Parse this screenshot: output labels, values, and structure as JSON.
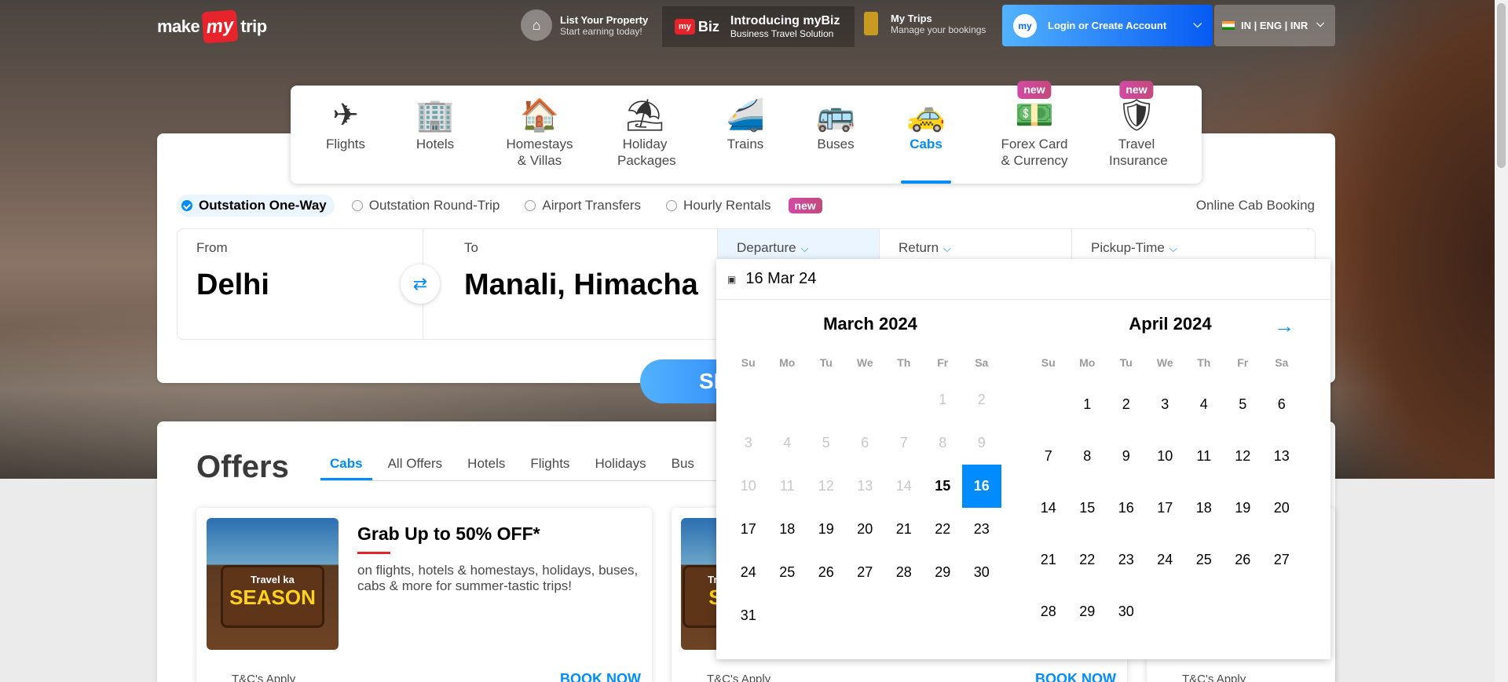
{
  "header": {
    "logo": {
      "part1": "make",
      "part2": "my",
      "part3": "trip"
    },
    "list_property": {
      "title": "List Your Property",
      "subtitle": "Start earning today!"
    },
    "mybiz": {
      "logo": "my",
      "word": "Biz",
      "title": "Introducing myBiz",
      "subtitle": "Business Travel Solution"
    },
    "my_trips": {
      "title": "My Trips",
      "subtitle": "Manage your bookings"
    },
    "login": {
      "label": "Login or Create Account",
      "avatar": "my"
    },
    "locale": {
      "label": "IN | ENG | INR"
    }
  },
  "nav": [
    {
      "label": "Flights",
      "icon": "plane-icon",
      "glyph": "✈"
    },
    {
      "label": "Hotels",
      "icon": "hotel-icon",
      "glyph": "🏢"
    },
    {
      "label": "Homestays & Villas",
      "icon": "home-icon",
      "glyph": "🏠"
    },
    {
      "label": "Holiday Packages",
      "icon": "umbrella-icon",
      "glyph": "⛱"
    },
    {
      "label": "Trains",
      "icon": "train-icon",
      "glyph": "🚄"
    },
    {
      "label": "Buses",
      "icon": "bus-icon",
      "glyph": "🚌"
    },
    {
      "label": "Cabs",
      "icon": "cab-icon",
      "glyph": "🚕",
      "active": true
    },
    {
      "label": "Forex Card & Currency",
      "icon": "forex-icon",
      "glyph": "💵",
      "badge": "new"
    },
    {
      "label": "Travel Insurance",
      "icon": "insurance-icon",
      "glyph": "🛡",
      "badge": "new"
    }
  ],
  "trip_types": [
    {
      "label": "Outstation One-Way",
      "selected": true
    },
    {
      "label": "Outstation Round-Trip"
    },
    {
      "label": "Airport Transfers"
    },
    {
      "label": "Hourly Rentals",
      "badge": "new"
    }
  ],
  "online_cab_booking": "Online Cab Booking",
  "fields": {
    "from": {
      "label": "From",
      "value": "Delhi"
    },
    "to": {
      "label": "To",
      "value": "Manali, Himachal Pradesh"
    },
    "departure": {
      "label": "Departure"
    },
    "return": {
      "label": "Return"
    },
    "pickup": {
      "label": "Pickup-Time"
    }
  },
  "search_button": "SEARCH",
  "datepicker": {
    "input_value": "16 Mar 24",
    "days_of_week": [
      "Su",
      "Mo",
      "Tu",
      "We",
      "Th",
      "Fr",
      "Sa"
    ],
    "months": [
      {
        "title": "March 2024",
        "first_weekday": 5,
        "days": 31,
        "disabled_before": 15,
        "today": 15,
        "selected": 16
      },
      {
        "title": "April 2024",
        "first_weekday": 1,
        "days": 30
      }
    ]
  },
  "offers": {
    "title": "Offers",
    "tabs": [
      "Cabs",
      "All Offers",
      "Hotels",
      "Flights",
      "Holidays",
      "Bus"
    ],
    "active_tab": 0,
    "cards": [
      {
        "title": "Grab Up to 50% OFF*",
        "desc": "on flights, hotels & homestays, holidays, buses, cabs & more for summer-tastic trips!",
        "tc": "T&C's Apply",
        "cta": "BOOK NOW",
        "img_line1": "Travel ka",
        "img_line2": "SEASON"
      },
      {
        "title": "",
        "desc": "",
        "tc": "T&C's Apply",
        "cta": "BOOK NOW",
        "img_line1": "Travel ka",
        "img_line2": "SEA"
      },
      {
        "title": "",
        "desc": "",
        "tc": "T&C's Apply",
        "cta": ""
      }
    ]
  },
  "colors": {
    "accent": "#008cff",
    "brand_red": "#e7242c",
    "new_badge": "#c24a7c"
  }
}
